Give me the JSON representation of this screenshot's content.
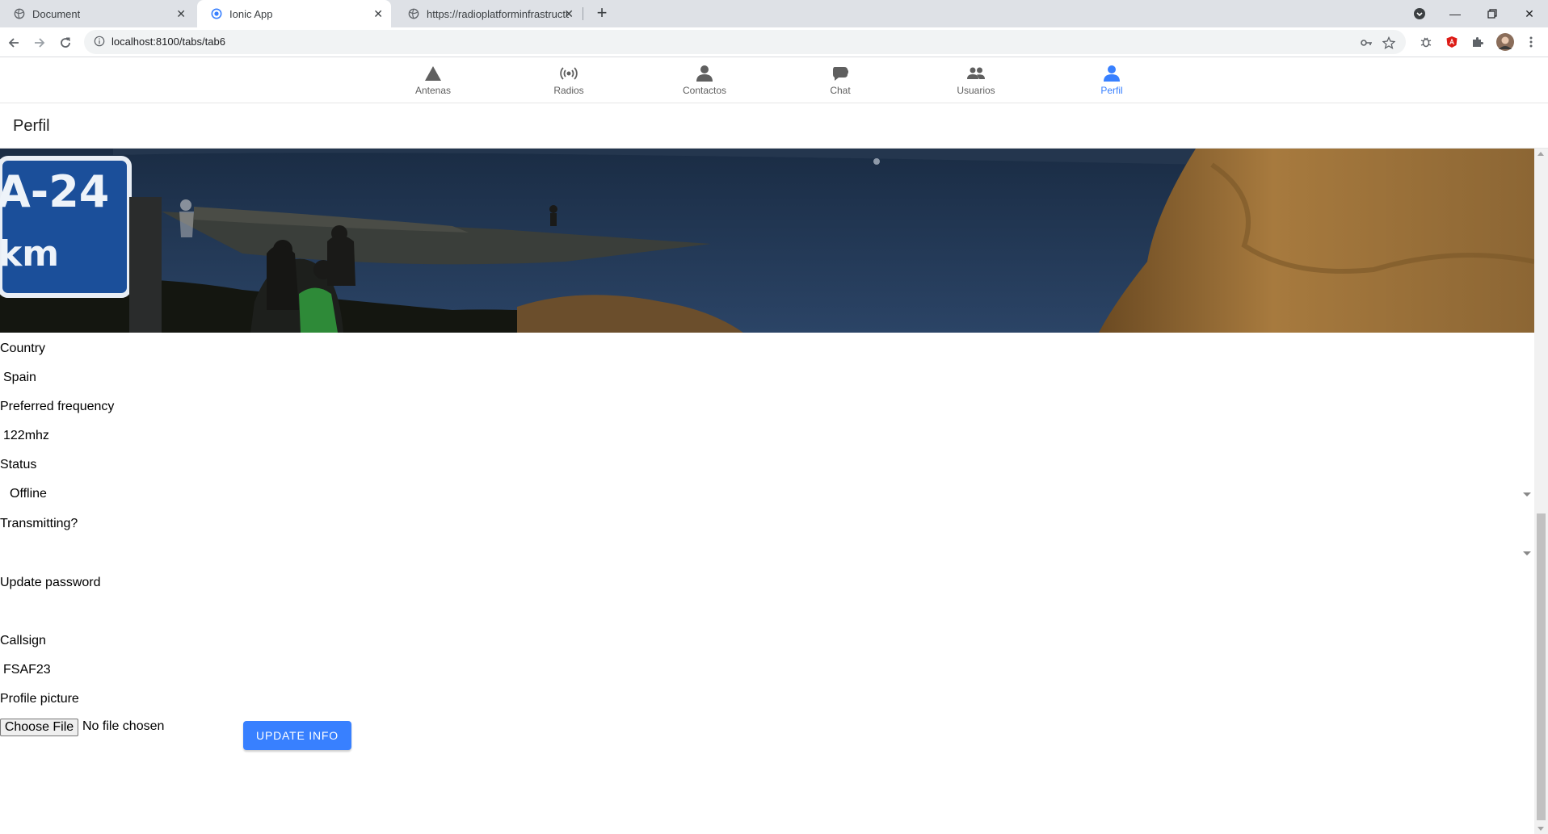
{
  "browser": {
    "tabs": [
      {
        "title": "Document",
        "active": false
      },
      {
        "title": "Ionic App",
        "active": true
      },
      {
        "title": "https://radioplatforminfrastructur",
        "active": false
      }
    ],
    "url": "localhost:8100/tabs/tab6"
  },
  "app": {
    "tabbar": [
      {
        "label": "Antenas",
        "icon": "triangle-icon"
      },
      {
        "label": "Radios",
        "icon": "radio-icon"
      },
      {
        "label": "Contactos",
        "icon": "person-icon"
      },
      {
        "label": "Chat",
        "icon": "chat-bubbles-icon"
      },
      {
        "label": "Usuarios",
        "icon": "people-icon"
      },
      {
        "label": "Perfil",
        "icon": "person-icon",
        "selected": true
      }
    ],
    "accent_color": "#3880ff",
    "page_title": "Perfil",
    "form": {
      "country_label": "Country",
      "country_value": "Spain",
      "frequency_label": "Preferred frequency",
      "frequency_value": "122mhz",
      "status_label": "Status",
      "status_value": "Offline",
      "transmitting_label": "Transmitting?",
      "transmitting_value": "",
      "password_label": "Update password",
      "password_value": "",
      "callsign_label": "Callsign",
      "callsign_value": "FSAF23",
      "picture_label": "Profile picture",
      "choose_file_label": "Choose File",
      "no_file_text": "No file chosen",
      "update_button": "UPDATE INFO"
    },
    "banner": {
      "sign_line1": "A-24",
      "sign_line2": "km"
    }
  }
}
